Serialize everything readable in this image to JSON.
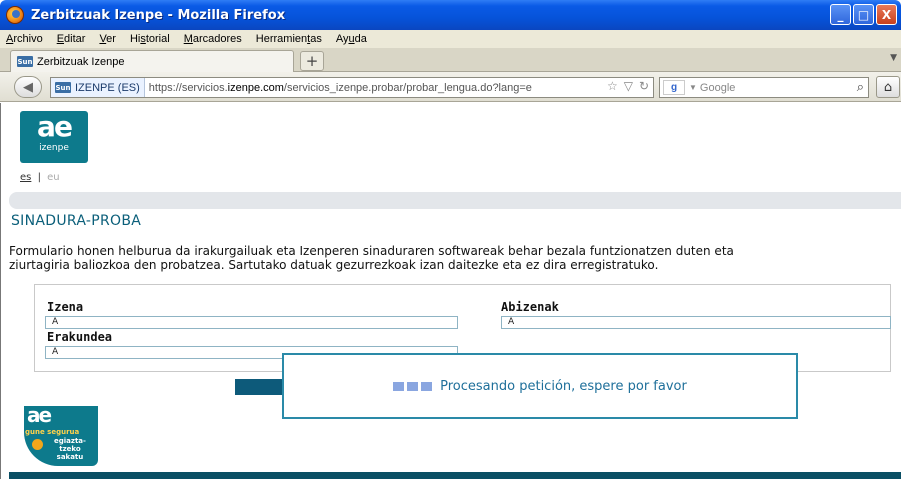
{
  "window": {
    "title": "Zerbitzuak Izenpe - Mozilla Firefox",
    "buttons": {
      "minimize": "_",
      "maximize": "□",
      "close": "X"
    }
  },
  "menu": {
    "items": [
      {
        "u": "A",
        "rest": "rchivo"
      },
      {
        "u": "E",
        "rest": "ditar"
      },
      {
        "u": "V",
        "rest": "er"
      },
      {
        "pre": "Hi",
        "u": "s",
        "rest": "torial"
      },
      {
        "u": "M",
        "rest": "arcadores"
      },
      {
        "pre": "Herramien",
        "u": "t",
        "rest": "as"
      },
      {
        "pre": "Ay",
        "u": "u",
        "rest": "da"
      }
    ]
  },
  "tabs": {
    "active_label": "Zerbitzuak Izenpe",
    "favicon": "Sun",
    "new_tab": "+"
  },
  "nav": {
    "identity_label": "IZENPE (ES)",
    "url_prefix": "https://servicios.",
    "url_domain": "izenpe.com",
    "url_suffix": "/servicios_izenpe.probar/probar_lengua.do?lang=e",
    "search_placeholder": "Google",
    "search_engine": "g"
  },
  "page": {
    "logo": {
      "mark": "ae",
      "name": "izenpe"
    },
    "lang": {
      "es": "es",
      "sep": "|",
      "eu": "eu"
    },
    "title": "SINADURA-PROBA",
    "description_line1": "Formulario honen helburua da irakurgailuak eta Izenperen sinaduraren softwareak behar bezala funtzionatzen duten eta",
    "description_line2": "ziurtagiria baliozkoa den probatzea. Sartutako datuak gezurrezkoak izan daitezke eta ez dira erregistratuko.",
    "form": {
      "name_label": "Izena",
      "name_value": "A",
      "surname_label": "Abizenak",
      "surname_value": "A",
      "org_label": "Erakundea",
      "org_value": "A"
    },
    "seal": {
      "mark": "ae",
      "line1": "gune segurua",
      "line2": "egiazta-",
      "line3": "tzeko",
      "line4": "sakatu"
    }
  },
  "loading": {
    "message": "Procesando petición, espere por favor"
  },
  "colors": {
    "brand_teal": "#0d7a8c",
    "title_blue": "#0b5f7a",
    "loading_border": "#2a8aa8",
    "xp_titlebar": "#0653d9"
  }
}
